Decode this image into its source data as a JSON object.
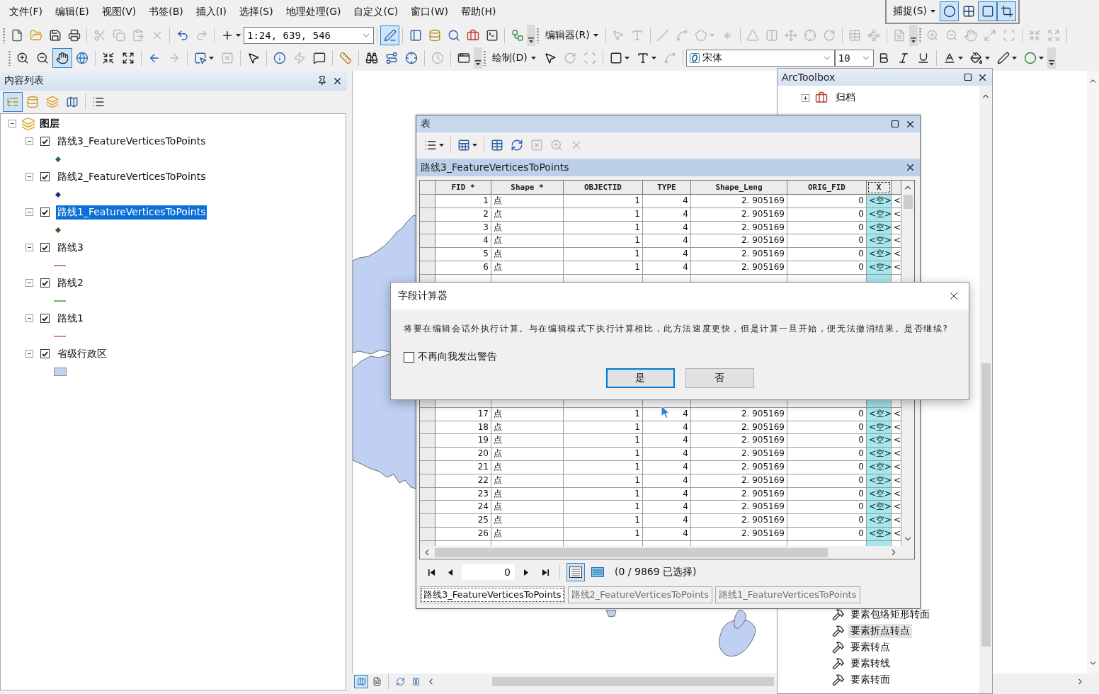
{
  "menu_bar": {
    "items": [
      "文件(F)",
      "编辑(E)",
      "视图(V)",
      "书签(B)",
      "插入(I)",
      "选择(S)",
      "地理处理(G)",
      "自定义(C)",
      "窗口(W)",
      "帮助(H)"
    ]
  },
  "snapping_toolbar": {
    "items": [
      {
        "kind": "menu",
        "label": "捕捉(S)"
      },
      {
        "kind": "button",
        "disabled": false,
        "selected": true
      },
      {
        "kind": "button",
        "disabled": false,
        "selected": false
      },
      {
        "kind": "button",
        "disabled": false,
        "selected": true
      },
      {
        "kind": "button",
        "disabled": false,
        "selected": true
      }
    ]
  },
  "toolbars": [
    {
      "items": [
        {
          "kind": "grip"
        },
        {
          "kind": "button",
          "disabled": false,
          "selected": false
        },
        {
          "kind": "button",
          "disabled": false,
          "selected": false
        },
        {
          "kind": "button",
          "disabled": false,
          "selected": false
        },
        {
          "kind": "button",
          "disabled": false,
          "selected": false
        },
        {
          "kind": "separator"
        },
        {
          "kind": "button",
          "disabled": true,
          "selected": false
        },
        {
          "kind": "button",
          "disabled": true,
          "selected": false
        },
        {
          "kind": "button",
          "disabled": true,
          "selected": false
        },
        {
          "kind": "button",
          "disabled": true,
          "selected": false
        },
        {
          "kind": "separator"
        },
        {
          "kind": "button",
          "disabled": false,
          "selected": false
        },
        {
          "kind": "button",
          "disabled": true,
          "selected": false
        },
        {
          "kind": "separator"
        },
        {
          "kind": "dropdown",
          "disabled": false,
          "selected": false
        },
        {
          "kind": "combo",
          "value": "1:24, 639, 546"
        },
        {
          "kind": "separator"
        },
        {
          "kind": "button",
          "disabled": false,
          "selected": true
        },
        {
          "kind": "separator"
        },
        {
          "kind": "button",
          "disabled": false,
          "selected": false
        },
        {
          "kind": "button",
          "disabled": false,
          "selected": false
        },
        {
          "kind": "button",
          "disabled": false,
          "selected": false
        },
        {
          "kind": "button",
          "disabled": false,
          "selected": false
        },
        {
          "kind": "button",
          "disabled": false,
          "selected": false
        },
        {
          "kind": "separator"
        },
        {
          "kind": "button",
          "disabled": false,
          "selected": false
        },
        {
          "kind": "overflow"
        },
        {
          "kind": "grip"
        },
        {
          "kind": "menu",
          "label": "编辑器(R)"
        },
        {
          "kind": "separator"
        },
        {
          "kind": "button",
          "disabled": true,
          "selected": false
        },
        {
          "kind": "button",
          "disabled": true,
          "selected": false
        },
        {
          "kind": "separator"
        },
        {
          "kind": "button",
          "disabled": true,
          "selected": false
        },
        {
          "kind": "button",
          "disabled": true,
          "selected": false
        },
        {
          "kind": "dropdown",
          "disabled": true,
          "selected": false
        },
        {
          "kind": "button",
          "disabled": true,
          "selected": false
        },
        {
          "kind": "separator"
        },
        {
          "kind": "button",
          "disabled": true,
          "selected": false
        },
        {
          "kind": "button",
          "disabled": true,
          "selected": false
        },
        {
          "kind": "button",
          "disabled": true,
          "selected": false
        },
        {
          "kind": "button",
          "disabled": true,
          "selected": false
        },
        {
          "kind": "button",
          "disabled": true,
          "selected": false
        },
        {
          "kind": "separator"
        },
        {
          "kind": "button",
          "disabled": true,
          "selected": false
        },
        {
          "kind": "button",
          "disabled": true,
          "selected": false
        },
        {
          "kind": "separator"
        },
        {
          "kind": "button",
          "disabled": true,
          "selected": false
        },
        {
          "kind": "overflow"
        },
        {
          "kind": "grip"
        },
        {
          "kind": "button",
          "disabled": true,
          "selected": false
        },
        {
          "kind": "button",
          "disabled": true,
          "selected": false
        },
        {
          "kind": "button",
          "disabled": true,
          "selected": false
        },
        {
          "kind": "button",
          "disabled": true,
          "selected": false
        },
        {
          "kind": "button",
          "disabled": true,
          "selected": false
        },
        {
          "kind": "separator"
        },
        {
          "kind": "button",
          "disabled": true,
          "selected": false
        },
        {
          "kind": "button",
          "disabled": true,
          "selected": false
        },
        {
          "kind": "separator"
        }
      ]
    },
    {
      "items": [
        {
          "kind": "grip"
        },
        {
          "kind": "button",
          "disabled": false,
          "selected": false
        },
        {
          "kind": "button",
          "disabled": false,
          "selected": false
        },
        {
          "kind": "button",
          "disabled": false,
          "selected": true
        },
        {
          "kind": "button",
          "disabled": false,
          "selected": false
        },
        {
          "kind": "separator"
        },
        {
          "kind": "button",
          "disabled": false,
          "selected": false
        },
        {
          "kind": "button",
          "disabled": false,
          "selected": false
        },
        {
          "kind": "separator"
        },
        {
          "kind": "button",
          "disabled": false,
          "selected": false
        },
        {
          "kind": "button",
          "disabled": true,
          "selected": false
        },
        {
          "kind": "separator"
        },
        {
          "kind": "dropdown",
          "disabled": false,
          "selected": false
        },
        {
          "kind": "button",
          "disabled": true,
          "selected": false
        },
        {
          "kind": "separator"
        },
        {
          "kind": "button",
          "disabled": false,
          "selected": false
        },
        {
          "kind": "separator"
        },
        {
          "kind": "button",
          "disabled": false,
          "selected": false
        },
        {
          "kind": "button",
          "disabled": true,
          "selected": false
        },
        {
          "kind": "button",
          "disabled": false,
          "selected": false
        },
        {
          "kind": "separator"
        },
        {
          "kind": "button",
          "disabled": false,
          "selected": false
        },
        {
          "kind": "separator"
        },
        {
          "kind": "button",
          "disabled": false,
          "selected": false
        },
        {
          "kind": "button",
          "disabled": false,
          "selected": false
        },
        {
          "kind": "button",
          "disabled": false,
          "selected": false
        },
        {
          "kind": "separator"
        },
        {
          "kind": "button",
          "disabled": true,
          "selected": false
        },
        {
          "kind": "separator"
        },
        {
          "kind": "button",
          "disabled": false,
          "selected": false
        },
        {
          "kind": "overflow"
        },
        {
          "kind": "grip"
        },
        {
          "kind": "menu",
          "label": "绘制(D)"
        },
        {
          "kind": "button",
          "disabled": false,
          "selected": false
        },
        {
          "kind": "button",
          "disabled": true,
          "selected": false
        },
        {
          "kind": "button",
          "disabled": true,
          "selected": false
        },
        {
          "kind": "separator"
        },
        {
          "kind": "dropdown",
          "disabled": false,
          "selected": false
        },
        {
          "kind": "dropdown",
          "disabled": false,
          "selected": false
        },
        {
          "kind": "button",
          "disabled": true,
          "selected": false
        },
        {
          "kind": "separator"
        },
        {
          "kind": "combo",
          "value": "宋体"
        },
        {
          "kind": "combo",
          "value": "10"
        },
        {
          "kind": "button",
          "disabled": false,
          "selected": false
        },
        {
          "kind": "button",
          "disabled": false,
          "selected": false
        },
        {
          "kind": "button",
          "disabled": false,
          "selected": false
        },
        {
          "kind": "separator"
        },
        {
          "kind": "dropdown",
          "disabled": false,
          "selected": false
        },
        {
          "kind": "dropdown",
          "disabled": false,
          "selected": false
        },
        {
          "kind": "dropdown",
          "disabled": false,
          "selected": false
        },
        {
          "kind": "dropdown",
          "disabled": false,
          "selected": false
        },
        {
          "kind": "overflow"
        }
      ]
    }
  ],
  "table_of_contents": {
    "title": "内容列表",
    "toolbar": {
      "items": [
        {
          "kind": "button",
          "disabled": false,
          "selected": true
        },
        {
          "kind": "button",
          "disabled": false,
          "selected": false
        },
        {
          "kind": "button",
          "disabled": false,
          "selected": false
        },
        {
          "kind": "button",
          "disabled": false,
          "selected": false
        },
        {
          "kind": "separator"
        },
        {
          "kind": "button",
          "disabled": false,
          "selected": false
        }
      ]
    },
    "tree": [
      {
        "label": "图层",
        "expanded": true,
        "selected": false,
        "children": [
          {
            "label": "路线3_FeatureVerticesToPoints",
            "checked": true,
            "expanded": true,
            "selected": false,
            "symbol": {
              "kind": "point",
              "color": "#1d6b52"
            }
          },
          {
            "label": "路线2_FeatureVerticesToPoints",
            "checked": true,
            "expanded": true,
            "selected": false,
            "symbol": {
              "kind": "point",
              "color": "#1c2d6b"
            }
          },
          {
            "label": "路线1_FeatureVerticesToPoints",
            "checked": true,
            "expanded": true,
            "selected": true,
            "symbol": {
              "kind": "point",
              "color": "#3b5c20"
            }
          },
          {
            "label": "路线3",
            "checked": true,
            "expanded": true,
            "selected": false,
            "symbol": {
              "kind": "line",
              "color": "#c08a68"
            }
          },
          {
            "label": "路线2",
            "checked": true,
            "expanded": true,
            "selected": false,
            "symbol": {
              "kind": "line",
              "color": "#74b062"
            }
          },
          {
            "label": "路线1",
            "checked": true,
            "expanded": true,
            "selected": false,
            "symbol": {
              "kind": "line",
              "color": "#d585a2"
            }
          },
          {
            "label": "省级行政区",
            "checked": true,
            "expanded": true,
            "selected": false,
            "symbol": {
              "kind": "polygon",
              "color": "#c4d1f2"
            }
          }
        ]
      }
    ]
  },
  "map": {
    "view_buttons": [
      {
        "selected": true
      },
      {
        "selected": false
      }
    ]
  },
  "arctoolbox": {
    "title": "ArcToolbox",
    "top_items": [
      {
        "label": "归档",
        "expanded": false,
        "selected": false
      }
    ],
    "bottom_items": [
      {
        "label": "要素包络矩形转面",
        "selected": false
      },
      {
        "label": "要素折点转点",
        "selected": true
      },
      {
        "label": "要素转点",
        "selected": false
      },
      {
        "label": "要素转线",
        "selected": false
      },
      {
        "label": "要素转面",
        "selected": false
      }
    ]
  },
  "table_window": {
    "title": "表",
    "toolbar": {
      "items": [
        {
          "kind": "dropdown",
          "disabled": false,
          "selected": false
        },
        {
          "kind": "separator"
        },
        {
          "kind": "dropdown",
          "disabled": false,
          "selected": false
        },
        {
          "kind": "separator"
        },
        {
          "kind": "button",
          "disabled": false,
          "selected": false
        },
        {
          "kind": "button",
          "disabled": false,
          "selected": false
        },
        {
          "kind": "button",
          "disabled": true,
          "selected": false
        },
        {
          "kind": "button",
          "disabled": true,
          "selected": false
        },
        {
          "kind": "button",
          "disabled": true,
          "selected": false
        }
      ]
    },
    "table_name": "路线3_FeatureVerticesToPoints",
    "columns": [
      {
        "label": "FID *",
        "kind": "number",
        "selected": false
      },
      {
        "label": "Shape *",
        "kind": "text",
        "selected": false
      },
      {
        "label": "OBJECTID",
        "kind": "number",
        "selected": false
      },
      {
        "label": "TYPE",
        "kind": "number",
        "selected": false
      },
      {
        "label": "Shape_Leng",
        "kind": "number",
        "selected": false
      },
      {
        "label": "ORIG_FID",
        "kind": "number",
        "selected": false
      },
      {
        "label": "X",
        "kind": "null",
        "selected": true
      },
      {
        "kind": "null",
        "selected": false
      }
    ],
    "rows_above_dialog": [
      [
        "1",
        "点",
        "1",
        "4",
        "2. 905169",
        "0",
        "<空>",
        "<"
      ],
      [
        "2",
        "点",
        "1",
        "4",
        "2. 905169",
        "0",
        "<空>",
        "<"
      ],
      [
        "3",
        "点",
        "1",
        "4",
        "2. 905169",
        "0",
        "<空>",
        "<"
      ],
      [
        "4",
        "点",
        "1",
        "4",
        "2. 905169",
        "0",
        "<空>",
        "<"
      ],
      [
        "5",
        "点",
        "1",
        "4",
        "2. 905169",
        "0",
        "<空>",
        "<"
      ],
      [
        "6",
        "点",
        "1",
        "4",
        "2. 905169",
        "0",
        "<空>",
        "<"
      ]
    ],
    "rows_below_dialog": [
      [
        "17",
        "点",
        "1",
        "4",
        "2. 905169",
        "0",
        "<空>",
        "<"
      ],
      [
        "18",
        "点",
        "1",
        "4",
        "2. 905169",
        "0",
        "<空>",
        "<"
      ],
      [
        "19",
        "点",
        "1",
        "4",
        "2. 905169",
        "0",
        "<空>",
        "<"
      ],
      [
        "20",
        "点",
        "1",
        "4",
        "2. 905169",
        "0",
        "<空>",
        "<"
      ],
      [
        "21",
        "点",
        "1",
        "4",
        "2. 905169",
        "0",
        "<空>",
        "<"
      ],
      [
        "22",
        "点",
        "1",
        "4",
        "2. 905169",
        "0",
        "<空>",
        "<"
      ],
      [
        "23",
        "点",
        "1",
        "4",
        "2. 905169",
        "0",
        "<空>",
        "<"
      ],
      [
        "24",
        "点",
        "1",
        "4",
        "2. 905169",
        "0",
        "<空>",
        "<"
      ],
      [
        "25",
        "点",
        "1",
        "4",
        "2. 905169",
        "0",
        "<空>",
        "<"
      ],
      [
        "26",
        "点",
        "1",
        "4",
        "2. 905169",
        "0",
        "<空>",
        "<"
      ]
    ],
    "navigation": {
      "record": "0",
      "view_buttons": [
        {
          "selected": true
        },
        {
          "selected": false
        }
      ],
      "status": "(0 / 9869 已选择)"
    },
    "tabs": [
      {
        "label": "路线3_FeatureVerticesToPoints",
        "selected": true
      },
      {
        "label": "路线2_FeatureVerticesToPoints",
        "selected": false
      },
      {
        "label": "路线1_FeatureVerticesToPoints",
        "selected": false
      }
    ]
  },
  "dialog": {
    "title": "字段计算器",
    "message": "将要在编辑会话外执行计算。与在编辑模式下执行计算相比，此方法速度更快，但是计算一旦开始，便无法撤消结果。是否继续?",
    "checkbox": {
      "label": "不再向我发出警告",
      "checked": false
    },
    "buttons": [
      {
        "label": "是",
        "focused": true
      },
      {
        "label": "否",
        "focused": false
      }
    ]
  }
}
